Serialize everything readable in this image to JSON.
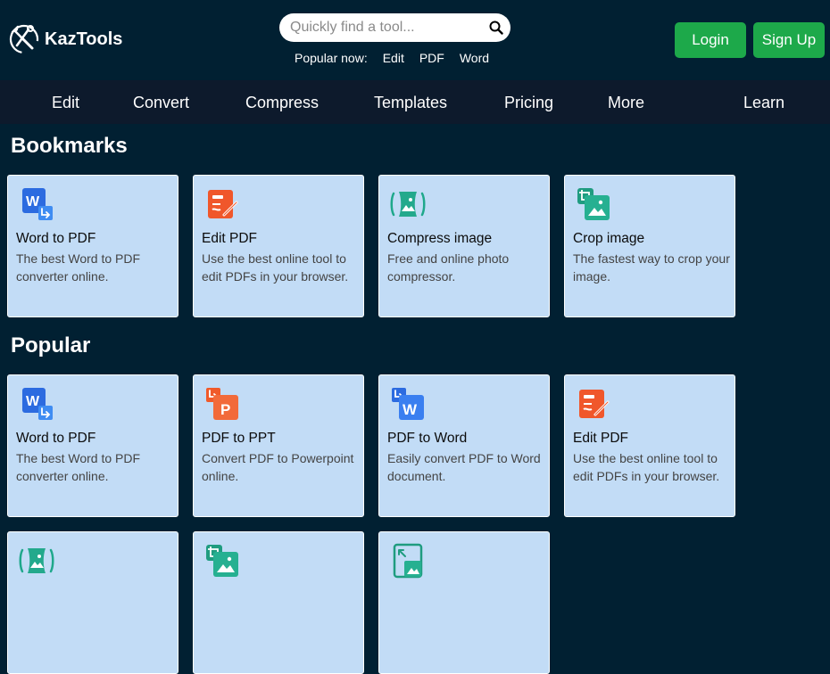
{
  "brand": {
    "name": "KazTools"
  },
  "search": {
    "placeholder": "Quickly find a tool..."
  },
  "popular_now": {
    "label": "Popular now:",
    "links": [
      "Edit",
      "PDF",
      "Word"
    ]
  },
  "auth": {
    "login": "Login",
    "signup": "Sign Up"
  },
  "nav": {
    "items": [
      "Edit",
      "Convert",
      "Compress",
      "Templates",
      "Pricing",
      "More",
      "Learn"
    ]
  },
  "bookmarks": {
    "title": "Bookmarks",
    "cards": [
      {
        "icon": "word-to-pdf-icon",
        "title": "Word to PDF",
        "desc": "The best Word to PDF converter online."
      },
      {
        "icon": "edit-pdf-icon",
        "title": "Edit PDF",
        "desc": "Use the best online tool to edit PDFs in your browser."
      },
      {
        "icon": "compress-image-icon",
        "title": "Compress image",
        "desc": "Free and online photo compressor."
      },
      {
        "icon": "crop-image-icon",
        "title": "Crop image",
        "desc": "The fastest way to crop your image."
      }
    ]
  },
  "popular": {
    "title": "Popular",
    "cards": [
      {
        "icon": "word-to-pdf-icon",
        "title": "Word to PDF",
        "desc": "The best Word to PDF converter online."
      },
      {
        "icon": "pdf-to-ppt-icon",
        "title": "PDF to PPT",
        "desc": "Convert PDF to Powerpoint online."
      },
      {
        "icon": "pdf-to-word-icon",
        "title": "PDF to Word",
        "desc": "Easily convert PDF to Word document."
      },
      {
        "icon": "edit-pdf-icon",
        "title": "Edit PDF",
        "desc": "Use the best online tool to edit PDFs in your browser."
      },
      {
        "icon": "compress-image-icon",
        "title": "",
        "desc": ""
      },
      {
        "icon": "crop-image-icon",
        "title": "",
        "desc": ""
      },
      {
        "icon": "resize-image-icon",
        "title": "",
        "desc": ""
      }
    ]
  },
  "colors": {
    "background": "#012032",
    "nav_bg": "#0d1a2c",
    "card_bg": "#c2dcf6",
    "button_green": "#1da94a"
  }
}
